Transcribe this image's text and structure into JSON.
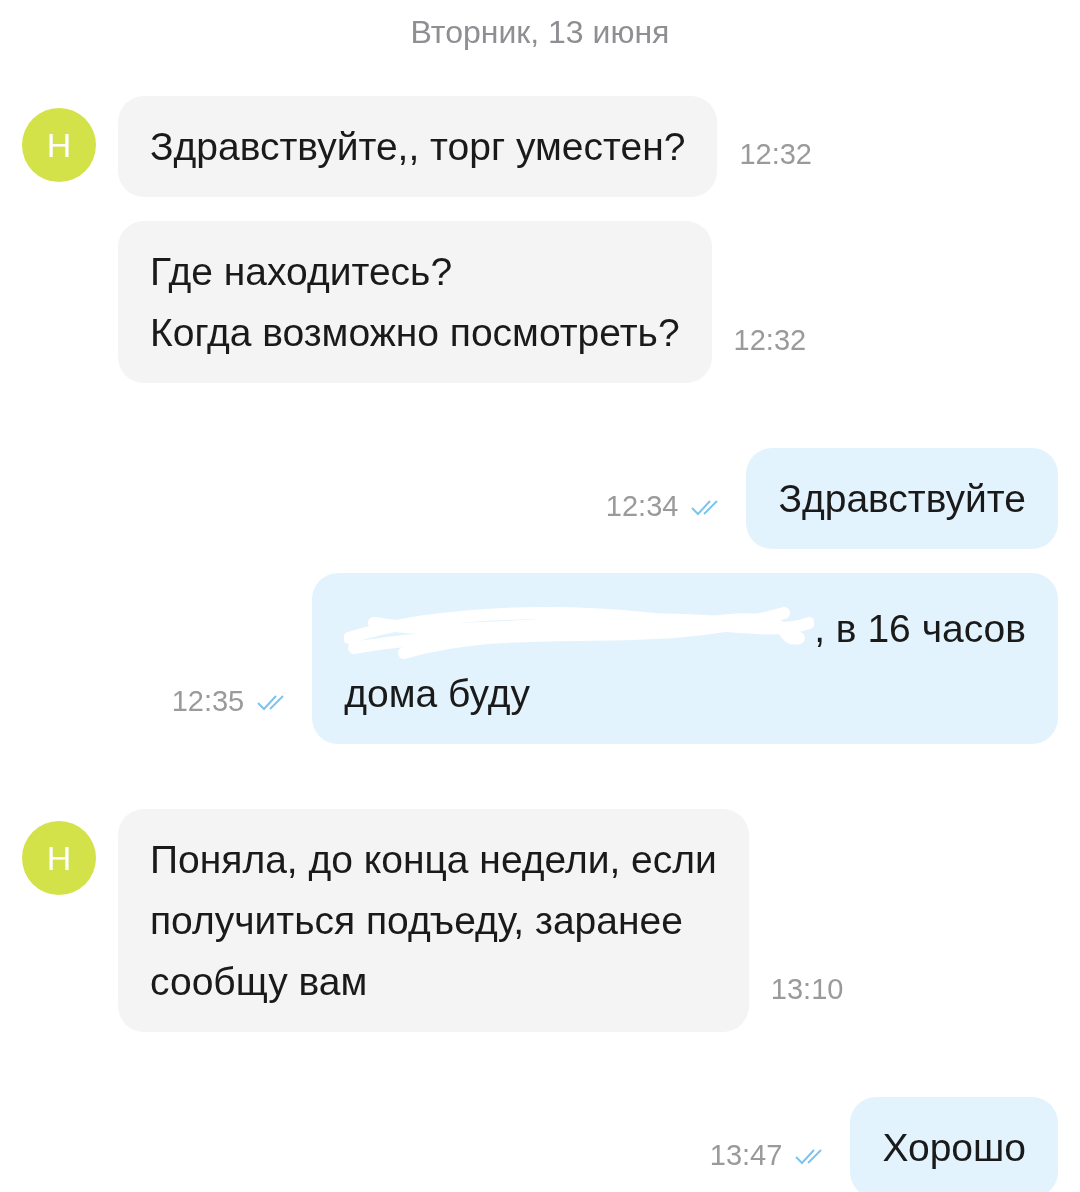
{
  "date": "Вторник, 13 июня",
  "groups": [
    {
      "kind": "incoming",
      "avatar": "Н",
      "messages": [
        {
          "lines": [
            "Здравствуйте,, торг уместен?"
          ],
          "time": "12:32"
        },
        {
          "lines": [
            "Где находитесь?",
            "Когда возможно посмотреть?"
          ],
          "time": "12:32"
        }
      ]
    },
    {
      "kind": "outgoing",
      "messages": [
        {
          "lines": [
            "Здравствуйте"
          ],
          "time": "12:34",
          "read": true
        },
        {
          "lines": [
            ", в 16 часов",
            "дома буду"
          ],
          "time": "12:35",
          "read": true,
          "redacted": true
        }
      ]
    },
    {
      "kind": "incoming",
      "avatar": "Н",
      "messages": [
        {
          "lines": [
            "Поняла, до конца недели, если",
            "получиться подъеду, заранее",
            "сообщу вам"
          ],
          "time": "13:10"
        }
      ]
    },
    {
      "kind": "outgoing",
      "messages": [
        {
          "lines": [
            "Хорошо"
          ],
          "time": "13:47",
          "read": true
        }
      ]
    }
  ]
}
